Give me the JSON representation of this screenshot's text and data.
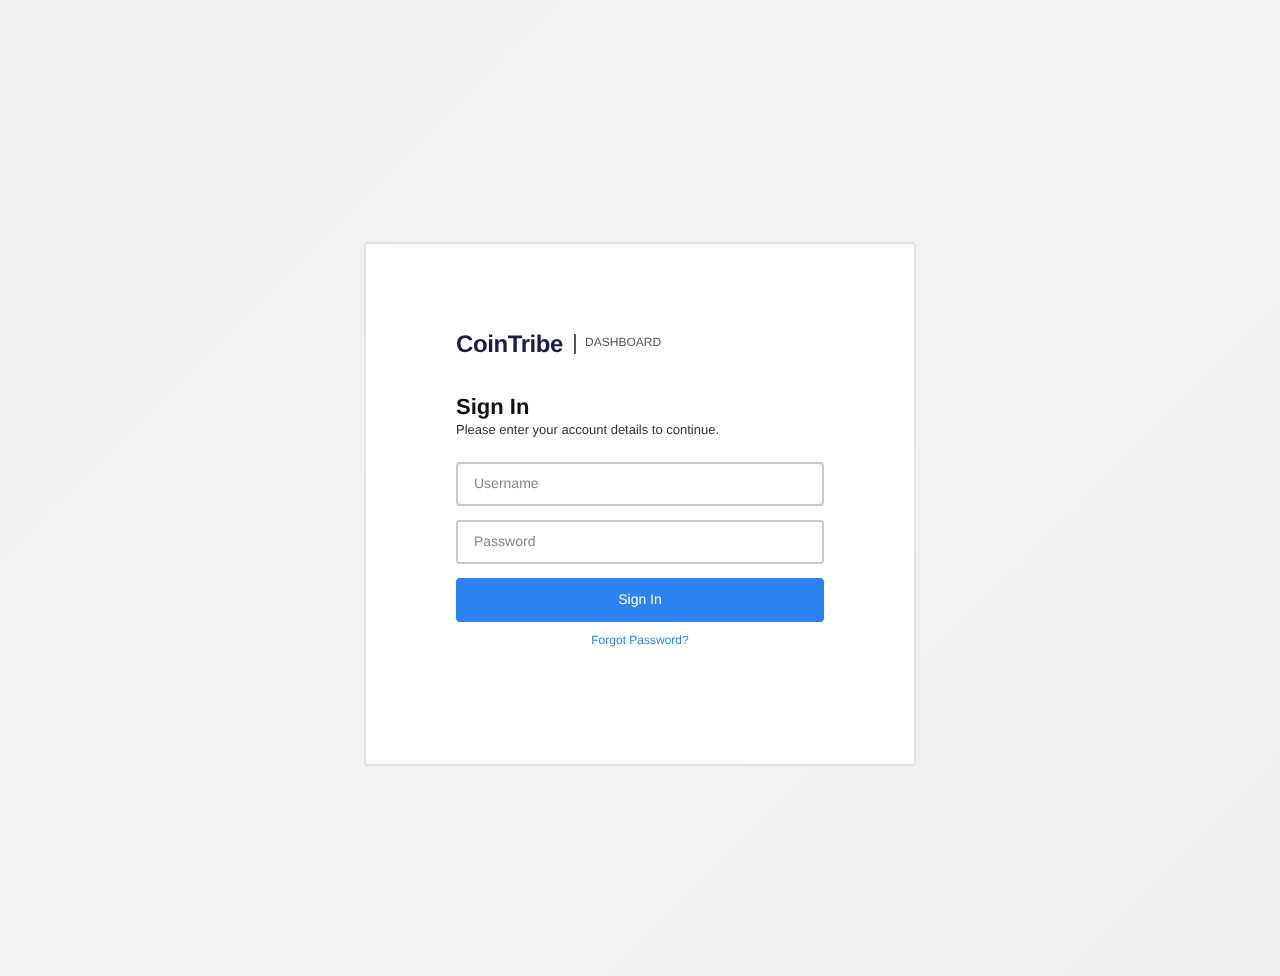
{
  "brand": {
    "logo": "CoinTribe",
    "section": "DASHBOARD"
  },
  "heading": "Sign In",
  "subtitle": "Please enter your account details to continue.",
  "fields": [
    {
      "placeholder": "Username"
    },
    {
      "placeholder": "Password"
    }
  ],
  "submit": "Sign In",
  "forgot_link": "Forgot Password?"
}
